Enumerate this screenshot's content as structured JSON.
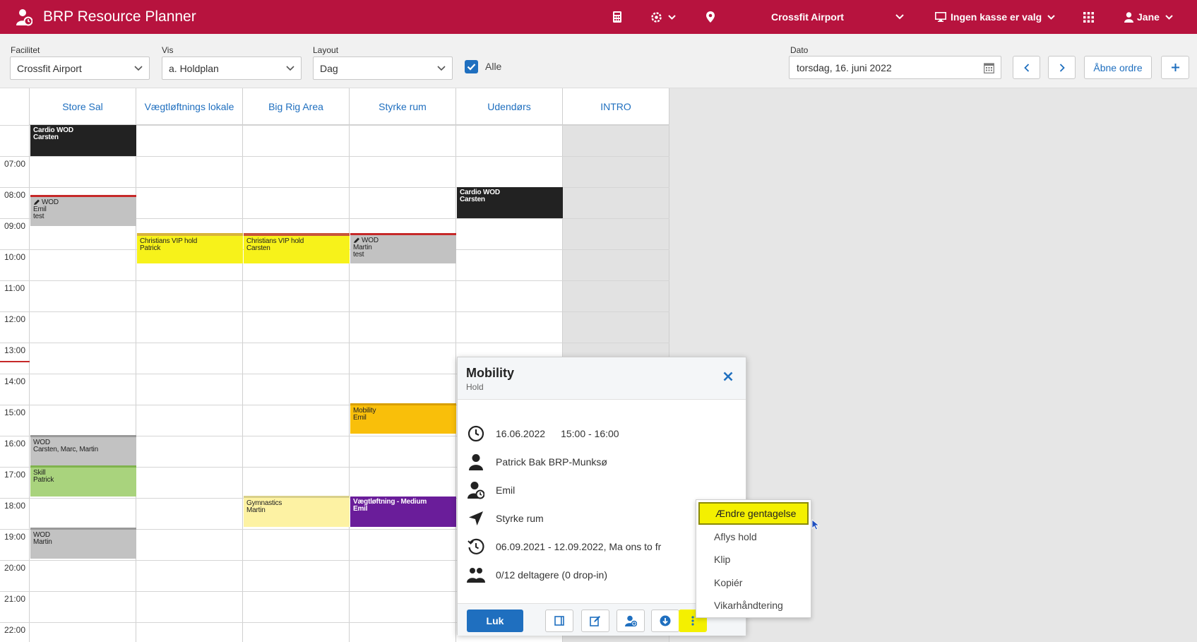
{
  "topbar": {
    "app_title": "BRP Resource Planner",
    "facility": "Crossfit Airport",
    "register": "Ingen kasse er valg",
    "user": "Jane",
    "colors": {
      "bar": "#b7133e"
    },
    "icons": [
      "logo-icon",
      "calculator-icon",
      "settings-icon",
      "location-pin-icon",
      "monitor-icon",
      "apps-grid-icon",
      "user-icon"
    ]
  },
  "filters": {
    "facilitet_label": "Facilitet",
    "facilitet_value": "Crossfit Airport",
    "vis_label": "Vis",
    "vis_value": "a. Holdplan",
    "layout_label": "Layout",
    "layout_value": "Dag",
    "alle_label": "Alle",
    "alle_checked": true,
    "dato_label": "Dato",
    "dato_value": "torsdag, 16. juni 2022",
    "open_orders_label": "Åbne ordre"
  },
  "calendar": {
    "columns": [
      "Store Sal",
      "Vægtløftnings lokale",
      "Big Rig Area",
      "Styrke rum",
      "Udendørs",
      "INTRO"
    ],
    "times": [
      "07:00",
      "08:00",
      "09:00",
      "10:00",
      "11:00",
      "12:00",
      "13:00",
      "14:00",
      "15:00",
      "16:00",
      "17:00",
      "18:00",
      "19:00",
      "20:00",
      "21:00",
      "22:00"
    ],
    "events": [
      {
        "id": "e1",
        "lines": [
          "Cardio WOD",
          "Carsten"
        ]
      },
      {
        "id": "e2",
        "lines": [
          "WOD",
          "Emil",
          "test"
        ]
      },
      {
        "id": "e3",
        "lines": [
          "WOD",
          "Carsten, Marc, Martin"
        ]
      },
      {
        "id": "e4",
        "lines": [
          "Skill",
          "Patrick"
        ]
      },
      {
        "id": "e5",
        "lines": [
          "WOD",
          "Martin"
        ]
      },
      {
        "id": "e6",
        "lines": [
          "Christians VIP hold",
          "Patrick"
        ]
      },
      {
        "id": "e7",
        "lines": [
          "Christians VIP hold",
          "Carsten"
        ]
      },
      {
        "id": "e8",
        "lines": [
          "Gymnastics",
          "Martin"
        ]
      },
      {
        "id": "e9",
        "lines": [
          "WOD",
          "Martin",
          "test"
        ]
      },
      {
        "id": "e10",
        "lines": [
          "Mobility",
          "Emil"
        ]
      },
      {
        "id": "e11",
        "lines": [
          "Vægtløftning - Medium",
          "Emil"
        ]
      },
      {
        "id": "e12",
        "lines": [
          "Cardio WOD",
          "Carsten"
        ]
      }
    ]
  },
  "popup": {
    "title": "Mobility",
    "subtitle": "Hold",
    "date": "16.06.2022",
    "time": "15:00 - 16:00",
    "owner": "Patrick Bak BRP-Munksø",
    "instructor": "Emil",
    "location": "Styrke rum",
    "recurrence": "06.09.2021 - 12.09.2022, Ma ons to fr",
    "participants": "0/12 deltagere (0 drop-in)",
    "close_label": "Luk"
  },
  "context_menu": {
    "items": [
      "Ændre gentagelse",
      "Aflys hold",
      "Klip",
      "Kopiér",
      "Vikarhåndtering"
    ],
    "highlight_color": "#f4f000"
  }
}
